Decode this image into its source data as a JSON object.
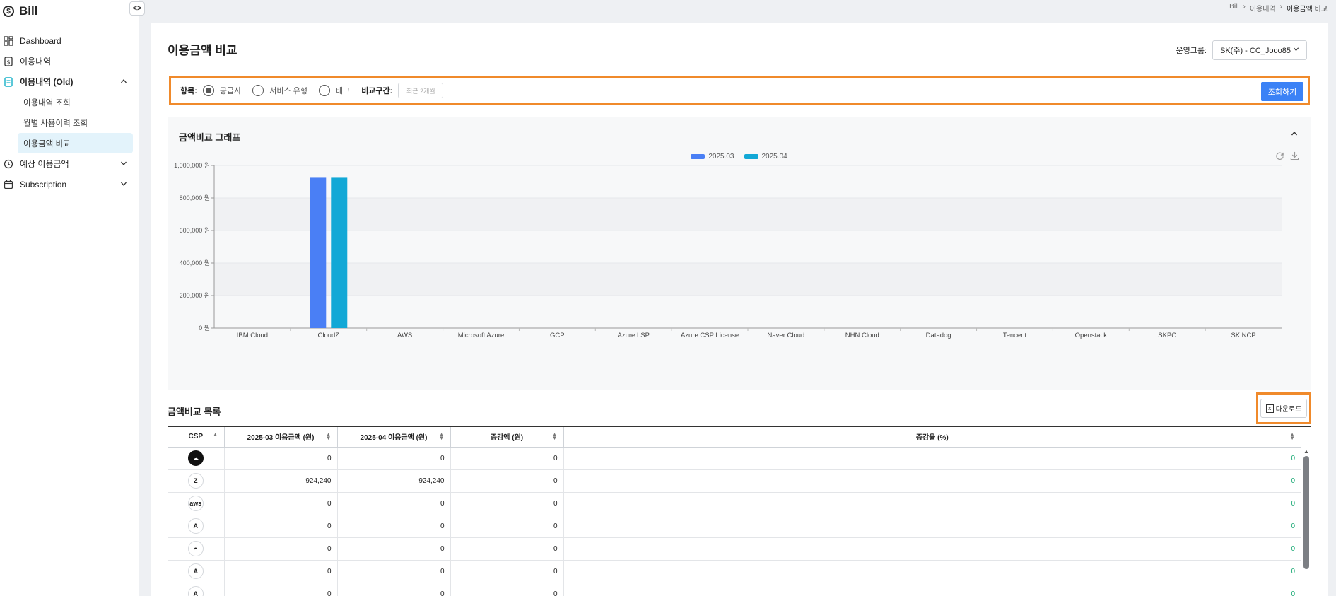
{
  "app": {
    "brand": "Bill"
  },
  "sidebar": {
    "items": [
      {
        "label": "Dashboard"
      },
      {
        "label": "이용내역"
      },
      {
        "label": "이용내역 (Old)",
        "sub": [
          "이용내역 조회",
          "월별 사용이력 조회",
          "이용금액 비교"
        ]
      },
      {
        "label": "예상 이용금액"
      },
      {
        "label": "Subscription"
      }
    ]
  },
  "breadcrumb": [
    "Bill",
    "이용내역",
    "이용금액 비교"
  ],
  "page": {
    "title": "이용금액 비교"
  },
  "group": {
    "label": "운영그룹:",
    "value": "SK(주) - CC_Jooo85"
  },
  "filter": {
    "item_label": "항목:",
    "options": [
      "공급사",
      "서비스 유형",
      "태그"
    ],
    "selected": 0,
    "range_label": "비교구간:",
    "range_placeholder": "최근 2개월",
    "search_label": "조회하기"
  },
  "chart_section": {
    "title": "금액비교 그래프"
  },
  "chart_data": {
    "type": "bar",
    "categories": [
      "IBM Cloud",
      "CloudZ",
      "AWS",
      "Microsoft Azure",
      "GCP",
      "Azure LSP",
      "Azure CSP License",
      "Naver Cloud",
      "NHN Cloud",
      "Datadog",
      "Tencent",
      "Openstack",
      "SKPC",
      "SK NCP"
    ],
    "series": [
      {
        "name": "2025.03",
        "color": "#4a7ff5",
        "values": [
          0,
          924240,
          0,
          0,
          0,
          0,
          0,
          0,
          0,
          0,
          0,
          0,
          0,
          0
        ]
      },
      {
        "name": "2025.04",
        "color": "#12a8d6",
        "values": [
          0,
          924240,
          0,
          0,
          0,
          0,
          0,
          0,
          0,
          0,
          0,
          0,
          0,
          0
        ]
      }
    ],
    "ylim": [
      0,
      1000000
    ],
    "yticks": [
      "0 원",
      "200,000 원",
      "400,000 원",
      "600,000 원",
      "800,000 원",
      "1,000,000 원"
    ],
    "yvalues": [
      0,
      200000,
      400000,
      600000,
      800000,
      1000000
    ]
  },
  "list_section": {
    "title": "금액비교 목록",
    "download_label": "다운로드"
  },
  "table": {
    "headers": [
      "CSP",
      "2025-03 이용금액 (원)",
      "2025-04 이용금액 (원)",
      "증감액 (원)",
      "증감율 (%)"
    ],
    "rows": [
      {
        "icon": "ibm-cloud-icon",
        "glyph": "☁",
        "v1": "0",
        "v2": "0",
        "diff": "0",
        "rate": "0"
      },
      {
        "icon": "cloudz-icon",
        "glyph": "Z",
        "v1": "924,240",
        "v2": "924,240",
        "diff": "0",
        "rate": "0"
      },
      {
        "icon": "aws-icon",
        "glyph": "aws",
        "v1": "0",
        "v2": "0",
        "diff": "0",
        "rate": "0"
      },
      {
        "icon": "azure-icon",
        "glyph": "A",
        "v1": "0",
        "v2": "0",
        "diff": "0",
        "rate": "0"
      },
      {
        "icon": "gcp-icon",
        "glyph": "◓",
        "v1": "0",
        "v2": "0",
        "diff": "0",
        "rate": "0"
      },
      {
        "icon": "azure-lsp-icon",
        "glyph": "A",
        "v1": "0",
        "v2": "0",
        "diff": "0",
        "rate": "0"
      },
      {
        "icon": "azure-csp-icon",
        "glyph": "A",
        "v1": "0",
        "v2": "0",
        "diff": "0",
        "rate": "0"
      }
    ]
  }
}
